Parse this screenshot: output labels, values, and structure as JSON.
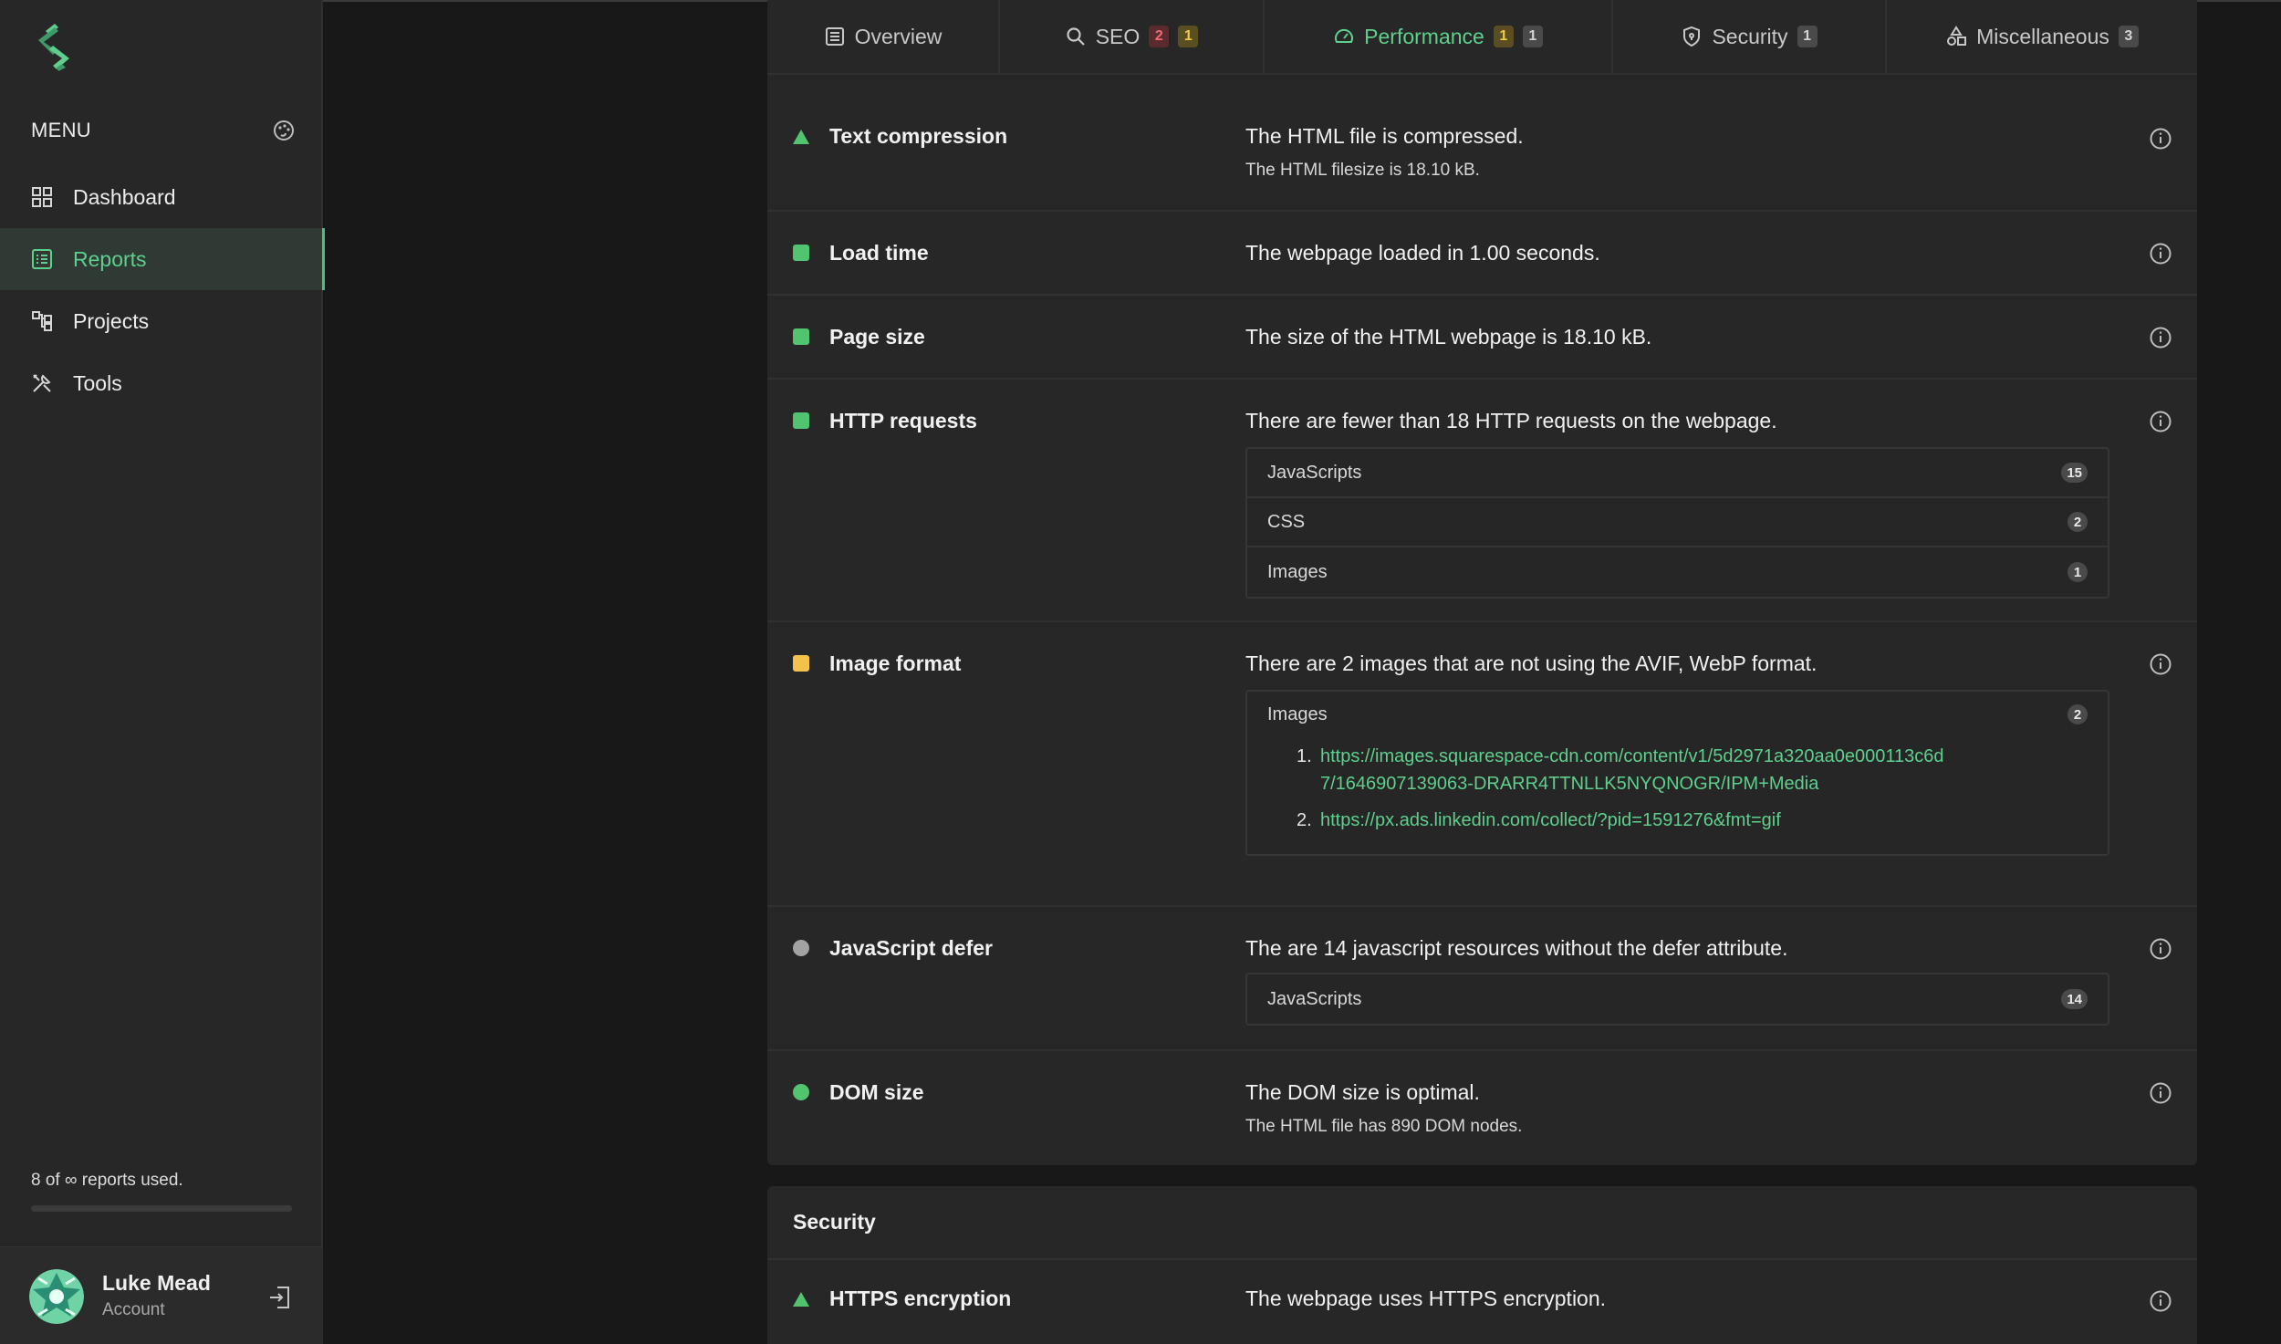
{
  "sidebar": {
    "menu_title": "MENU",
    "items": [
      {
        "label": "Dashboard",
        "icon": "dashboard-icon"
      },
      {
        "label": "Reports",
        "icon": "reports-icon",
        "active": true
      },
      {
        "label": "Projects",
        "icon": "projects-icon"
      },
      {
        "label": "Tools",
        "icon": "tools-icon"
      }
    ],
    "usage_text": "8 of ∞ reports used.",
    "user_name": "Luke Mead",
    "user_sub": "Account"
  },
  "tabs": [
    {
      "label": "Overview",
      "icon": "list-icon",
      "badges": []
    },
    {
      "label": "SEO",
      "icon": "search-icon",
      "badges": [
        "2",
        "1"
      ]
    },
    {
      "label": "Performance",
      "icon": "gauge-icon",
      "badges": [
        "1",
        "1"
      ],
      "active": true
    },
    {
      "label": "Security",
      "icon": "shield-icon",
      "badges": [
        "1"
      ]
    },
    {
      "label": "Miscellaneous",
      "icon": "shapes-icon",
      "badges": [
        "3"
      ]
    }
  ],
  "rows": {
    "text_compression": {
      "title": "Text compression",
      "msg": "The HTML file is compressed.",
      "sub": "The HTML filesize is 18.10 kB."
    },
    "load_time": {
      "title": "Load time",
      "msg": "The webpage loaded in 1.00 seconds."
    },
    "page_size": {
      "title": "Page size",
      "msg": "The size of the HTML webpage is 18.10 kB."
    },
    "http_requests": {
      "title": "HTTP requests",
      "msg": "There are fewer than 18 HTTP requests on the webpage.",
      "items": [
        {
          "label": "JavaScripts",
          "count": "15"
        },
        {
          "label": "CSS",
          "count": "2"
        },
        {
          "label": "Images",
          "count": "1"
        }
      ]
    },
    "image_format": {
      "title": "Image format",
      "msg": "There are 2 images that are not using the AVIF, WebP format.",
      "box_label": "Images",
      "box_count": "2",
      "links": [
        {
          "num": "1.",
          "url": "https://images.squarespace-cdn.com/content/v1/5d2971a320aa0e000113c6d7/1646907139063-DRARR4TTNLLK5NYQNOGR/IPM+Media"
        },
        {
          "num": "2.",
          "url": "https://px.ads.linkedin.com/collect/?pid=1591276&fmt=gif"
        }
      ]
    },
    "js_defer": {
      "title": "JavaScript defer",
      "msg": "The are 14 javascript resources without the defer attribute.",
      "box_label": "JavaScripts",
      "box_count": "14"
    },
    "dom_size": {
      "title": "DOM size",
      "msg": "The DOM size is optimal.",
      "sub": "The HTML file has 890 DOM nodes."
    }
  },
  "security": {
    "heading": "Security",
    "https": {
      "title": "HTTPS encryption",
      "msg": "The webpage uses HTTPS encryption."
    }
  }
}
